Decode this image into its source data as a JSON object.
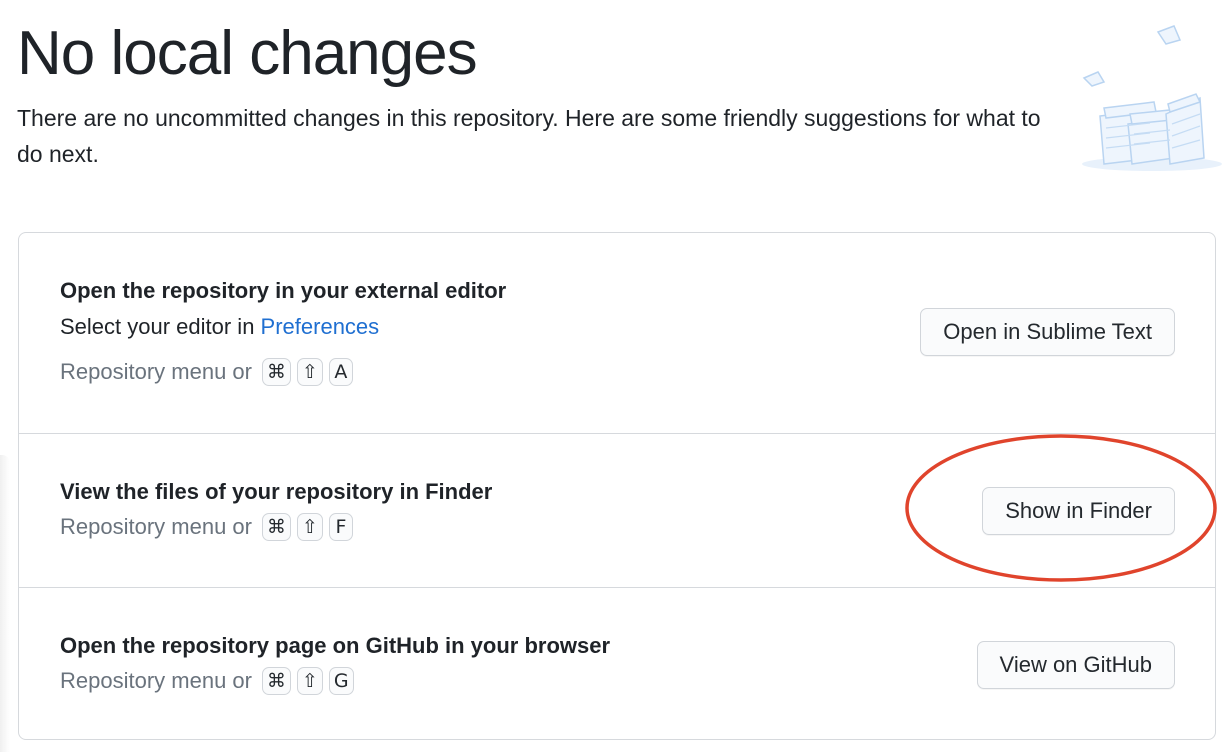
{
  "header": {
    "title": "No local changes",
    "subtitle": "There are no uncommitted changes in this repository. Here are some friendly suggestions for what to do next."
  },
  "illustration": {
    "icon": "paper-stacks-illustration"
  },
  "suggestions": [
    {
      "title": "Open the repository in your external editor",
      "description_prefix": "Select your editor in ",
      "description_link": "Preferences",
      "shortcut_prefix": "Repository menu or",
      "keys": [
        "⌘",
        "⇧",
        "A"
      ],
      "button_label": "Open in Sublime Text"
    },
    {
      "title": "View the files of your repository in Finder",
      "shortcut_prefix": "Repository menu or",
      "keys": [
        "⌘",
        "⇧",
        "F"
      ],
      "button_label": "Show in Finder"
    },
    {
      "title": "Open the repository page on GitHub in your browser",
      "shortcut_prefix": "Repository menu or",
      "keys": [
        "⌘",
        "⇧",
        "G"
      ],
      "button_label": "View on GitHub"
    }
  ],
  "colors": {
    "link": "#1f6fd1",
    "annotation": "#e0442c",
    "illustration": "#cfe2f7"
  }
}
